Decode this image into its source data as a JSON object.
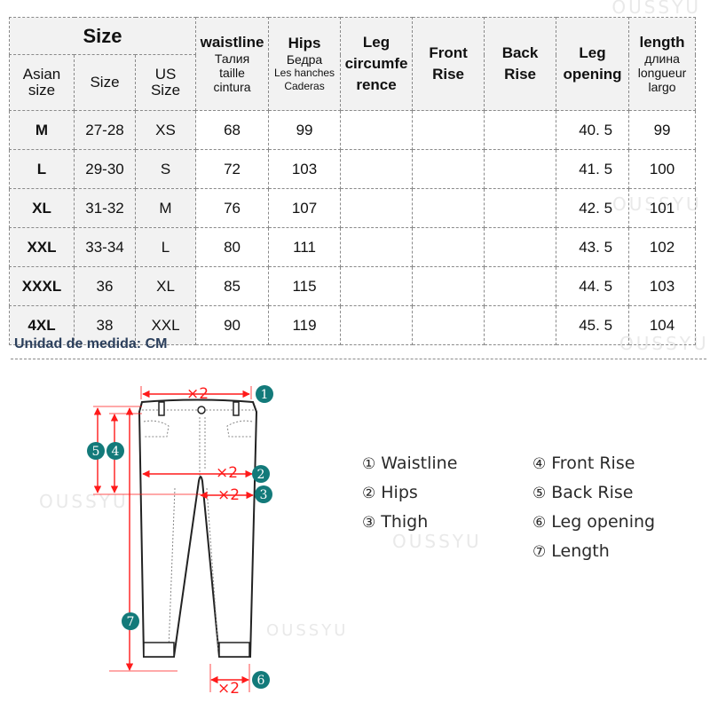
{
  "table": {
    "header": {
      "size_group": "Size",
      "asian_size": "Asian size",
      "size": "Size",
      "us_size": "US Size",
      "waistline": {
        "title": "waistline",
        "t1": "Талия",
        "t2": "taille",
        "t3": "cintura"
      },
      "hips": {
        "title": "Hips",
        "t1": "Бедра",
        "t2": "Les hanches",
        "t3": "Caderas"
      },
      "leg_circumference": {
        "l1": "Leg",
        "l2": "circumfe",
        "l3": "rence"
      },
      "front_rise": {
        "l1": "Front",
        "l2": "Rise"
      },
      "back_rise": {
        "l1": "Back",
        "l2": "Rise"
      },
      "leg_opening": {
        "l1": "Leg",
        "l2": "opening"
      },
      "length": {
        "title": "length",
        "t1": "длина",
        "t2": "longueur",
        "t3": "largo"
      }
    },
    "rows": [
      {
        "asian": "M",
        "size": "27-28",
        "us": "XS",
        "waist": "68",
        "hips": "99",
        "leg_circ": "",
        "front_rise": "",
        "back_rise": "",
        "leg_opening": "40. 5",
        "length": "99"
      },
      {
        "asian": "L",
        "size": "29-30",
        "us": "S",
        "waist": "72",
        "hips": "103",
        "leg_circ": "",
        "front_rise": "",
        "back_rise": "",
        "leg_opening": "41. 5",
        "length": "100"
      },
      {
        "asian": "XL",
        "size": "31-32",
        "us": "M",
        "waist": "76",
        "hips": "107",
        "leg_circ": "",
        "front_rise": "",
        "back_rise": "",
        "leg_opening": "42. 5",
        "length": "101"
      },
      {
        "asian": "XXL",
        "size": "33-34",
        "us": "L",
        "waist": "80",
        "hips": "111",
        "leg_circ": "",
        "front_rise": "",
        "back_rise": "",
        "leg_opening": "43. 5",
        "length": "102"
      },
      {
        "asian": "XXXL",
        "size": "36",
        "us": "XL",
        "waist": "85",
        "hips": "115",
        "leg_circ": "",
        "front_rise": "",
        "back_rise": "",
        "leg_opening": "44. 5",
        "length": "103"
      },
      {
        "asian": "4XL",
        "size": "38",
        "us": "XXL",
        "waist": "90",
        "hips": "119",
        "leg_circ": "",
        "front_rise": "",
        "back_rise": "",
        "leg_opening": "45. 5",
        "length": "104"
      }
    ]
  },
  "unit_note": "Unidad de medida: CM",
  "diagram": {
    "multiplier": "×2",
    "markers": [
      "1",
      "2",
      "3",
      "4",
      "5",
      "6",
      "7"
    ],
    "colors": {
      "line": "#ff1a1a",
      "badge": "#137a7a",
      "outline": "#222222"
    }
  },
  "legend": [
    {
      "num": "①",
      "label": "Waistline"
    },
    {
      "num": "②",
      "label": "Hips"
    },
    {
      "num": "③",
      "label": "Thigh"
    },
    {
      "num": "④",
      "label": "Front Rise"
    },
    {
      "num": "⑤",
      "label": "Back Rise"
    },
    {
      "num": "⑥",
      "label": "Leg opening"
    },
    {
      "num": "⑦",
      "label": "Length"
    }
  ],
  "watermark": "OUSSYU"
}
